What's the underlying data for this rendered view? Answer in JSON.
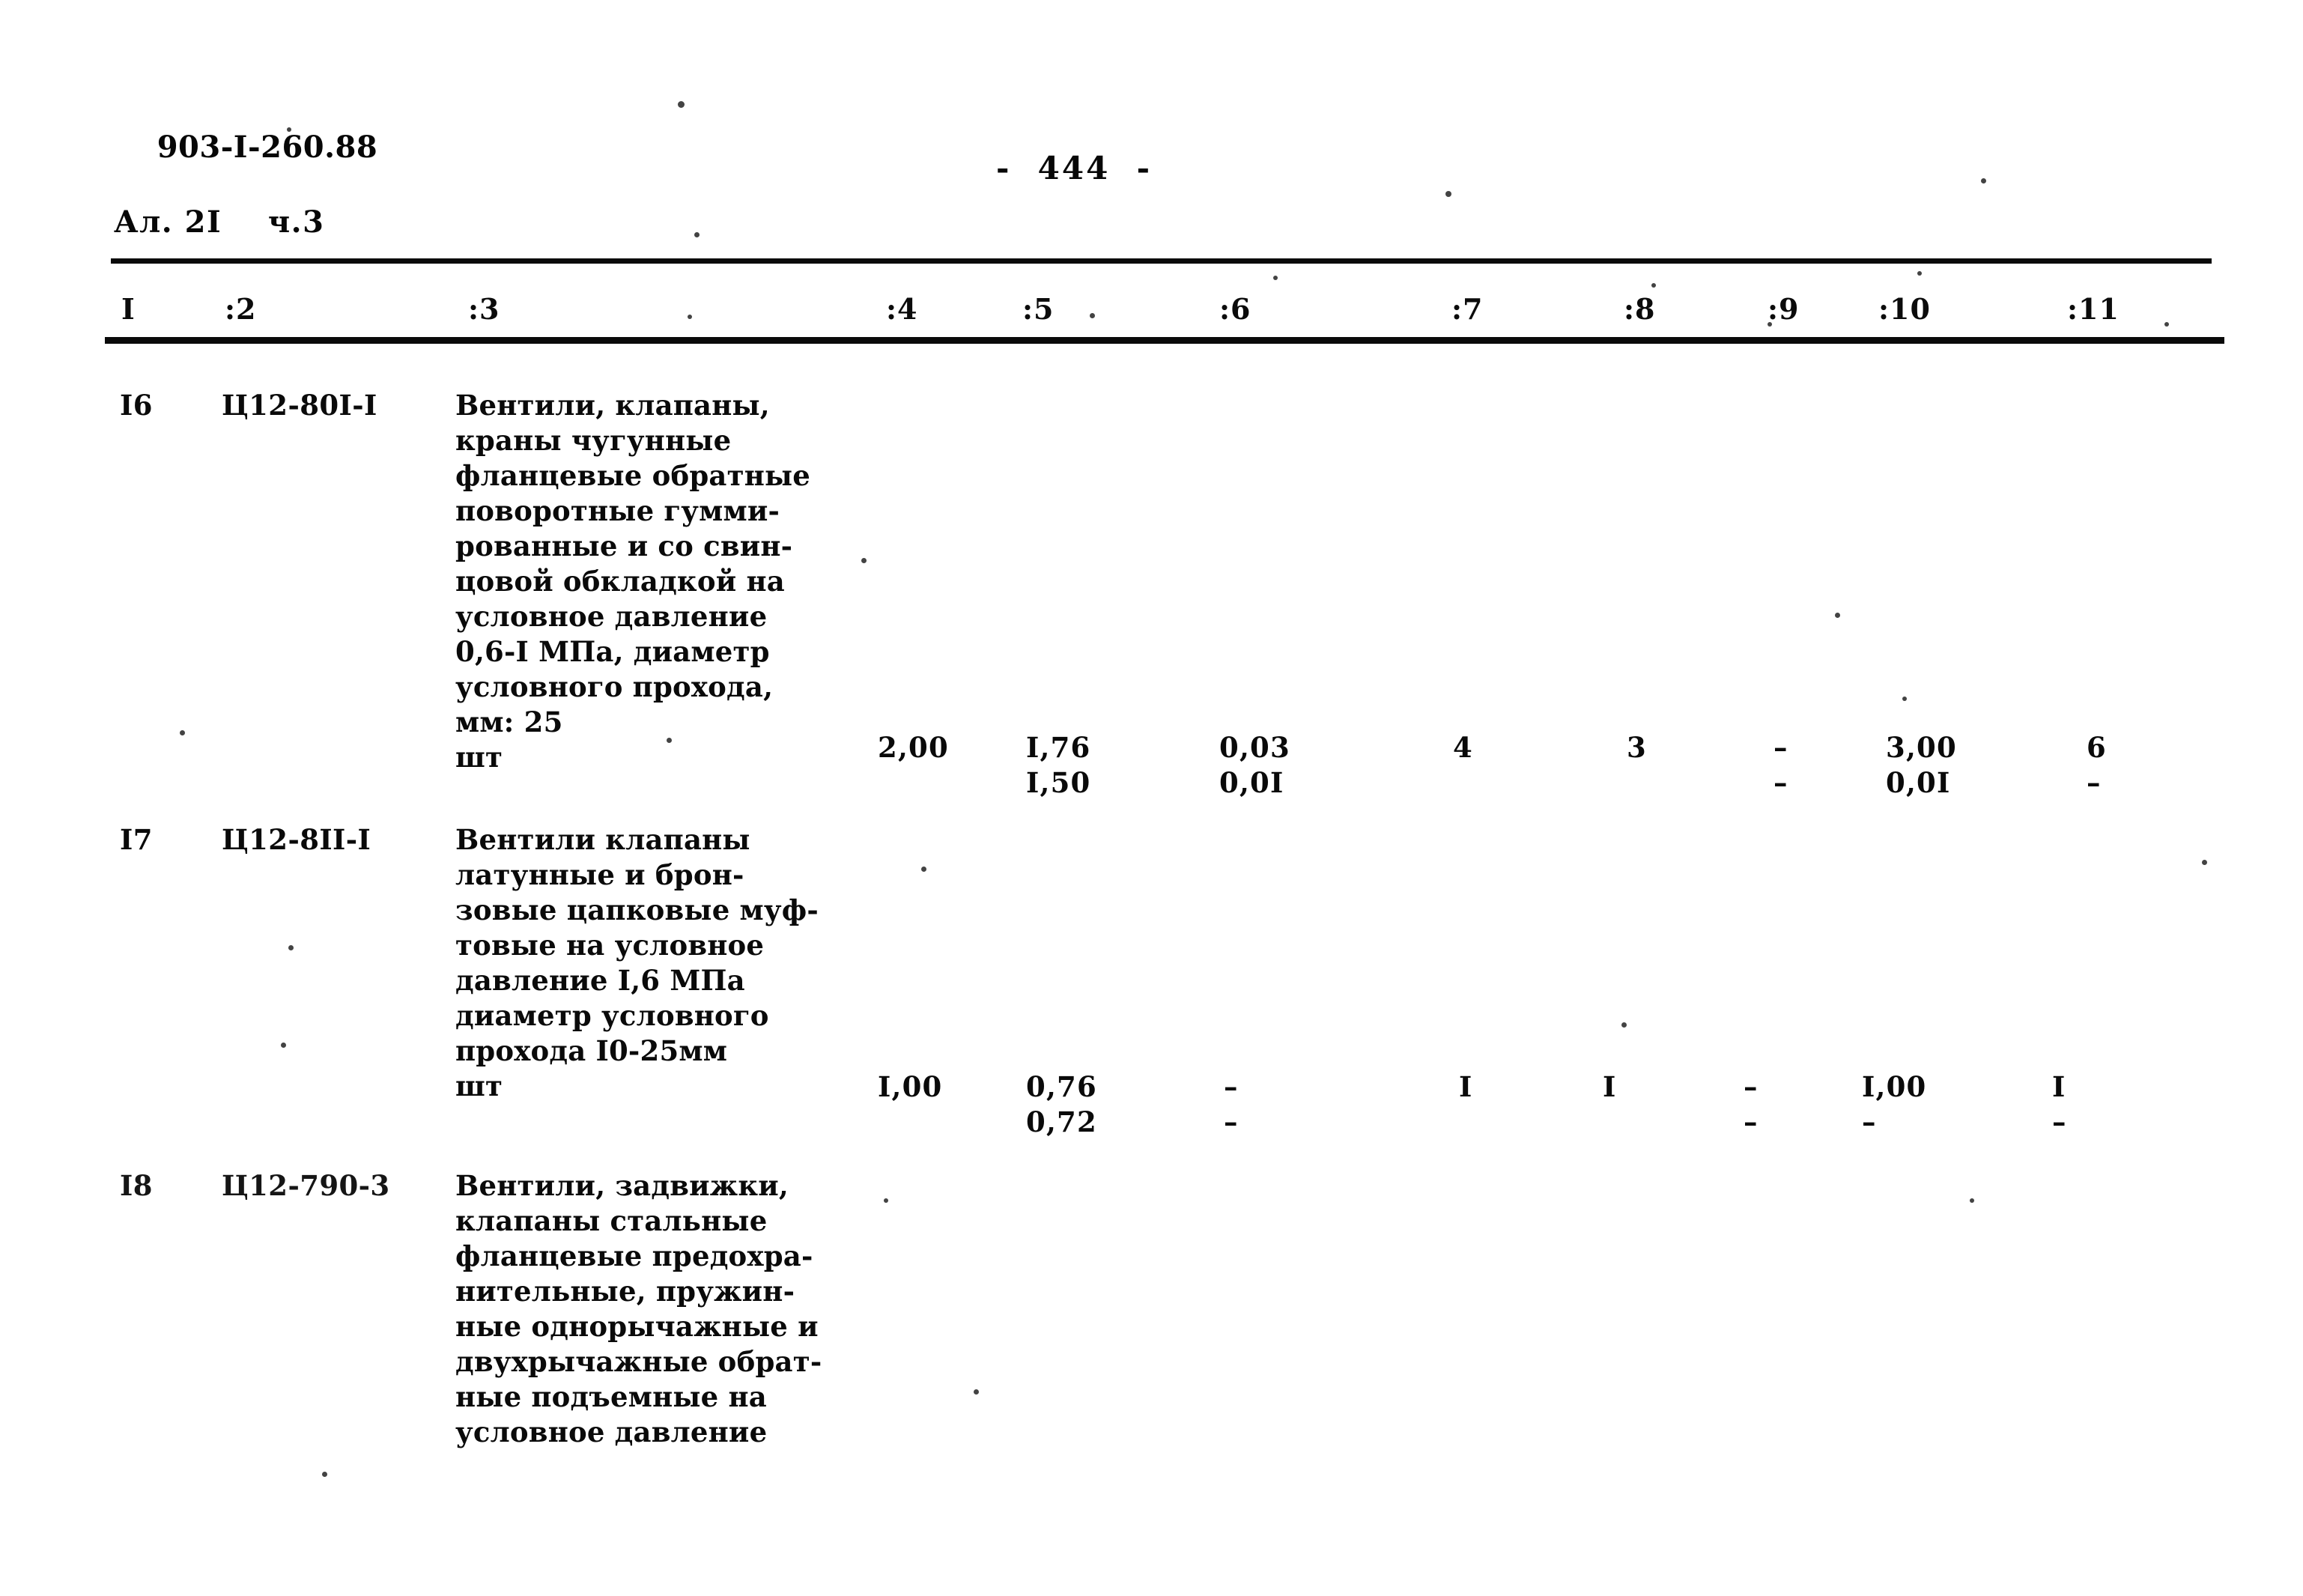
{
  "document": {
    "code": "903-I-260.88",
    "album_line": "Ал. 2I    ч.3",
    "page_number": "-  444  -"
  },
  "table": {
    "column_headers": [
      "I",
      ":2",
      ":3",
      ":4",
      ":5",
      ":6",
      ":7",
      ":8",
      ":9",
      ":10",
      ":11"
    ],
    "rows": [
      {
        "no": "I6",
        "code": "Ц12-80I-I",
        "description": "Вентили, клапаны,\nкраны чугунные\nфланцевые обратные\nповоротные гумми-\nрованные и со свин-\nцовой обкладкой на\nусловное давление\n0,6-I МПа, диаметр\nусловного прохода,\nмм: 25\nшт",
        "unit": "шт",
        "c4": "2,00",
        "c5": "I,76\nI,50",
        "c6": "0,03\n0,0I",
        "c7": "4",
        "c8": "3",
        "c9": "–\n–",
        "c10": "3,00\n0,0I",
        "c11": "6\n–"
      },
      {
        "no": "I7",
        "code": "Ц12-8II-I",
        "description": "Вентили клапаны\nлатунные и брон-\nзовые цапковые муф-\nтовые на условное\nдавление I,6 МПа\nдиаметр условного\nпрохода I0-25мм\nшт",
        "unit": "шт",
        "c4": "I,00",
        "c5": "0,76\n0,72",
        "c6": "–\n–",
        "c7": "I",
        "c8": "I",
        "c9": "–\n–",
        "c10": "I,00\n–",
        "c11": "I\n–"
      },
      {
        "no": "I8",
        "code": "Ц12-790-3",
        "description": "Вентили, задвижки,\nклапаны стальные\nфланцевые предохра-\nнительные, пружин-\nные однорычажные и\nдвухрычажные обрат-\nные подъемные на\nусловное давление",
        "unit": "",
        "c4": "",
        "c5": "",
        "c6": "",
        "c7": "",
        "c8": "",
        "c9": "",
        "c10": "",
        "c11": ""
      }
    ]
  }
}
